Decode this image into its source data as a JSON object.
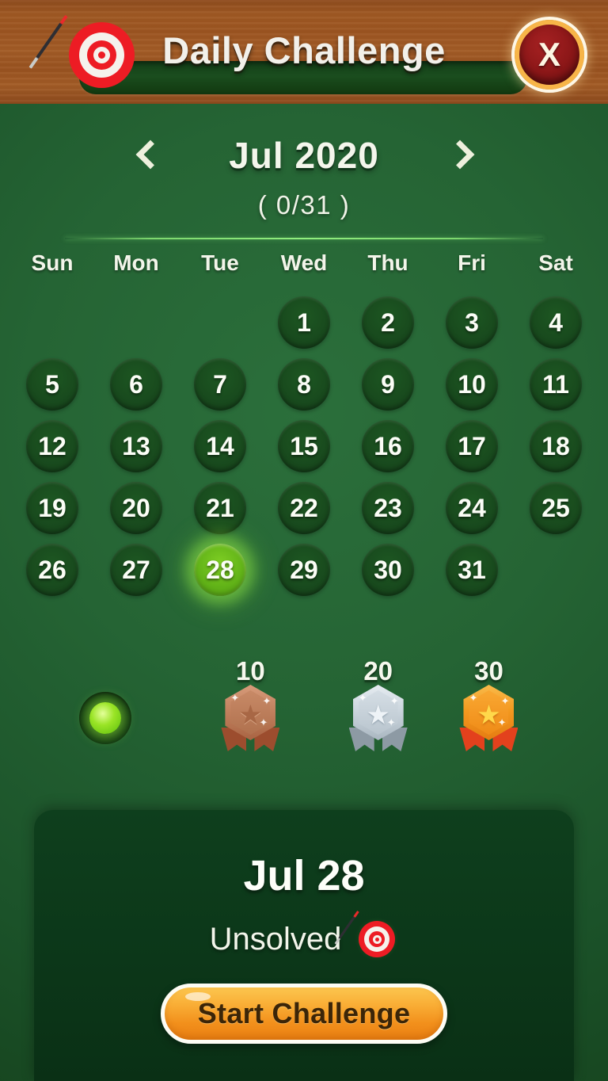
{
  "header": {
    "title": "Daily Challenge",
    "target_icon": "target-icon",
    "close_label": "X"
  },
  "month_nav": {
    "prev_icon": "chevron-left-icon",
    "next_icon": "chevron-right-icon",
    "month_label": "Jul 2020",
    "progress_label": "( 0/31 )"
  },
  "calendar": {
    "weekdays": [
      "Sun",
      "Mon",
      "Tue",
      "Wed",
      "Thu",
      "Fri",
      "Sat"
    ],
    "leading_blanks": 3,
    "days": [
      "1",
      "2",
      "3",
      "4",
      "5",
      "6",
      "7",
      "8",
      "9",
      "10",
      "11",
      "12",
      "13",
      "14",
      "15",
      "16",
      "17",
      "18",
      "19",
      "20",
      "21",
      "22",
      "23",
      "24",
      "25",
      "26",
      "27",
      "28",
      "29",
      "30",
      "31"
    ],
    "selected_day": "28",
    "solved_days": []
  },
  "rewards": {
    "milestones": [
      {
        "label": "10",
        "medal": "bronze-medal-icon",
        "x_percent": 41.2
      },
      {
        "label": "20",
        "medal": "silver-medal-icon",
        "x_percent": 62.2
      },
      {
        "label": "30",
        "medal": "gold-medal-icon",
        "x_percent": 80.4
      }
    ],
    "progress_value": 0,
    "progress_max": 30
  },
  "detail": {
    "date": "Jul 28",
    "status": "Unsolved",
    "status_icon": "target-icon",
    "start_button": "Start Challenge"
  },
  "colors": {
    "header_wood": "#9d5521",
    "background_green": "#256434",
    "card_green": "#0c3719",
    "accent_orange": "#f5a328",
    "today_green": "#7fcf24",
    "close_red": "#8c1718"
  }
}
